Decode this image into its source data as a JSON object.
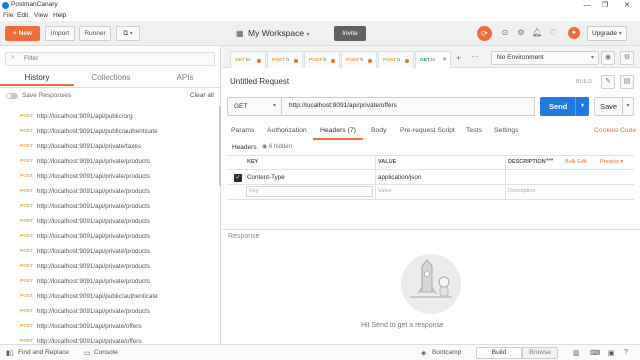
{
  "window": {
    "title": "PostmanCanary",
    "controls": [
      "—",
      "❐",
      "✕"
    ]
  },
  "menu": [
    "File",
    "Edit",
    "View",
    "Help"
  ],
  "header": {
    "new_label": "+ New",
    "import_label": "Import",
    "runner_label": "Runner",
    "workspace_label": "My Workspace",
    "invite_label": "Invite",
    "upgrade_label": "Upgrade",
    "accent": "#f26b3a"
  },
  "sidebar": {
    "filter_placeholder": "Filter",
    "tabs": [
      "History",
      "Collections",
      "APIs"
    ],
    "save_responses_label": "Save Responses",
    "clear_all_label": "Clear all",
    "history": [
      {
        "method": "POST",
        "url": "http://localhost:9091/api/public/org"
      },
      {
        "method": "POST",
        "url": "http://localhost:9091/api/public/authenticate"
      },
      {
        "method": "POST",
        "url": "http://localhost:9091/api/private/taxes"
      },
      {
        "method": "POST",
        "url": "http://localhost:9091/api/private/products"
      },
      {
        "method": "POST",
        "url": "http://localhost:9091/api/private/products"
      },
      {
        "method": "POST",
        "url": "http://localhost:9091/api/private/products"
      },
      {
        "method": "POST",
        "url": "http://localhost:9091/api/private/products"
      },
      {
        "method": "POST",
        "url": "http://localhost:9091/api/private/products"
      },
      {
        "method": "POST",
        "url": "http://localhost:9091/api/private/products"
      },
      {
        "method": "POST",
        "url": "http://localhost:9091/api/private/products"
      },
      {
        "method": "POST",
        "url": "http://localhost:9091/api/private/products"
      },
      {
        "method": "POST",
        "url": "http://localhost:9091/api/private/products"
      },
      {
        "method": "POST",
        "url": "http://localhost:9091/api/public/authenticate"
      },
      {
        "method": "POST",
        "url": "http://localhost:9091/api/private/products"
      },
      {
        "method": "POST",
        "url": "http://localhost:9091/api/private/offers"
      },
      {
        "method": "POST",
        "url": "http://localhost:9091/api/private/offers"
      }
    ]
  },
  "request_tabs": [
    {
      "method": "GET",
      "title": "lo"
    },
    {
      "method": "POST",
      "title": "h"
    },
    {
      "method": "POST",
      "title": "h"
    },
    {
      "method": "POST",
      "title": "h"
    },
    {
      "method": "POST",
      "title": "h"
    },
    {
      "method": "GET",
      "title": "lo"
    }
  ],
  "environment": {
    "selected": "No Environment"
  },
  "request": {
    "name": "Untitled Request",
    "build_label": "BUILD",
    "method": "GET",
    "url": "http://localhost:9091/api/private/offers",
    "send_label": "Send",
    "save_label": "Save"
  },
  "sub_tabs": {
    "params": "Params",
    "authorization": "Authorization",
    "headers": "Headers (7)",
    "body": "Body",
    "prerequest": "Pre-request Script",
    "tests": "Tests",
    "settings": "Settings",
    "cookies": "Cookies",
    "code": "Code"
  },
  "headers_section": {
    "label": "Headers",
    "hidden_label": "6 hidden",
    "columns": {
      "key": "KEY",
      "value": "VALUE",
      "description": "DESCRIPTION"
    },
    "bulk_edit_label": "Bulk Edit",
    "presets_label": "Presets",
    "rows": [
      {
        "key": "Content-Type",
        "value": "application/json",
        "description": ""
      }
    ],
    "new_row": {
      "key_placeholder": "Key",
      "value_placeholder": "Value",
      "description_placeholder": "Description"
    }
  },
  "response": {
    "label": "Response",
    "empty_text": "Hit Send to get a response"
  },
  "statusbar": {
    "find_replace": "Find and Replace",
    "console": "Console",
    "bootcamp": "Bootcamp",
    "build": "Build",
    "browse": "Browse"
  }
}
